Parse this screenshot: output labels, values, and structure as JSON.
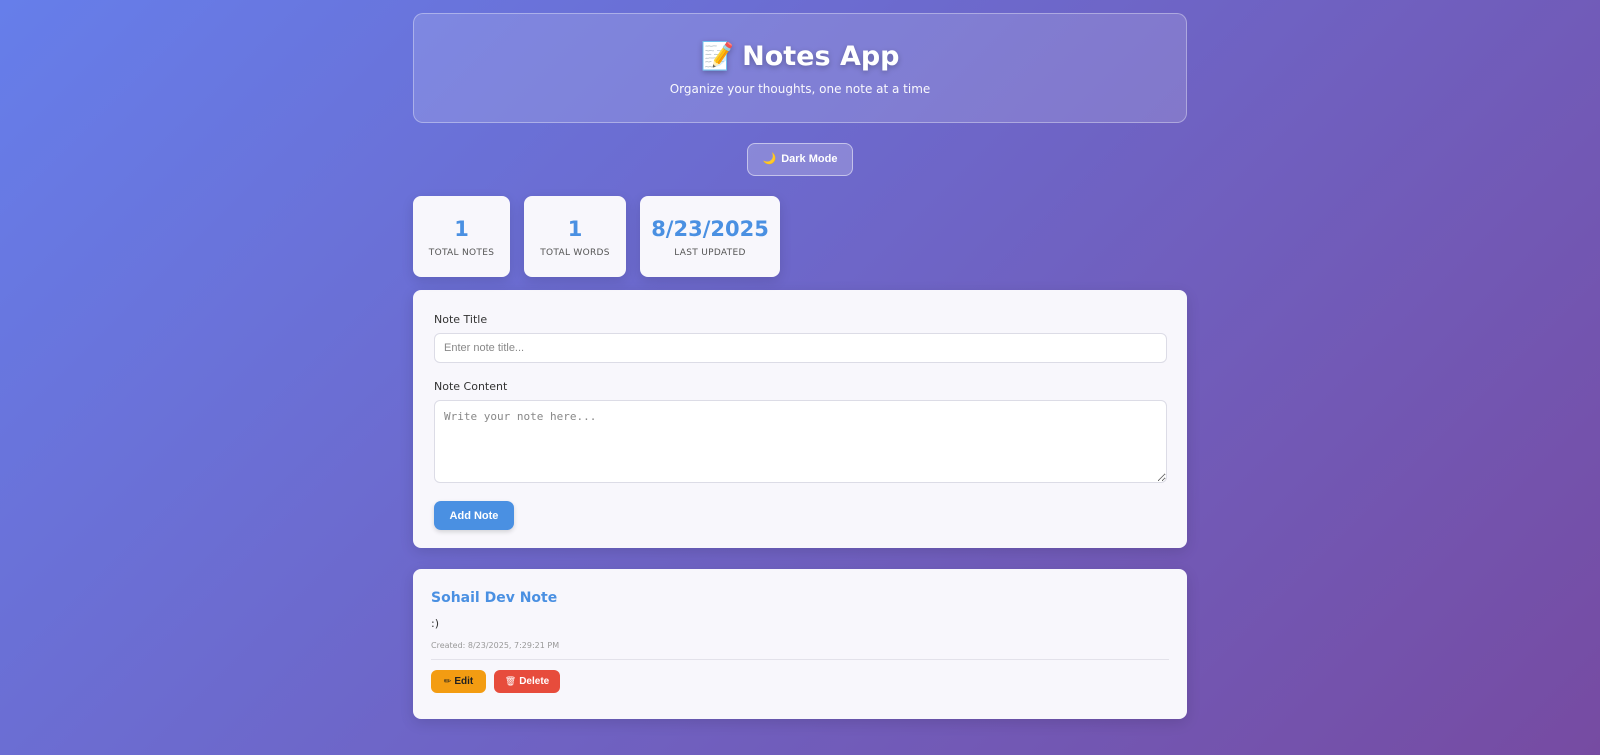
{
  "header": {
    "icon": "memo-icon",
    "icon_glyph": "📝",
    "title": "Notes App",
    "subtitle": "Organize your thoughts, one note at a time"
  },
  "theme_toggle": {
    "icon": "moon-icon",
    "icon_glyph": "🌙",
    "label": "Dark Mode"
  },
  "stats": [
    {
      "value": "1",
      "label": "TOTAL NOTES"
    },
    {
      "value": "1",
      "label": "TOTAL WORDS"
    },
    {
      "value": "8/23/2025",
      "label": "LAST UPDATED"
    }
  ],
  "form": {
    "title_label": "Note Title",
    "title_placeholder": "Enter note title...",
    "title_value": "",
    "content_label": "Note Content",
    "content_placeholder": "Write your note here...",
    "content_value": "",
    "submit_label": "Add Note"
  },
  "notes": [
    {
      "title": "Sohail Dev Note",
      "content": ":)",
      "created": "Created: 8/23/2025, 7:29:21 PM",
      "edit_label": "Edit",
      "edit_icon": "pencil-icon",
      "edit_glyph": "✏",
      "delete_label": "Delete",
      "delete_icon": "trash-icon",
      "delete_glyph": "🗑"
    }
  ],
  "colors": {
    "accent": "#4a90e2",
    "background_start": "#667eea",
    "background_end": "#764ba2",
    "edit": "#f39c12",
    "delete": "#e74c3c"
  }
}
